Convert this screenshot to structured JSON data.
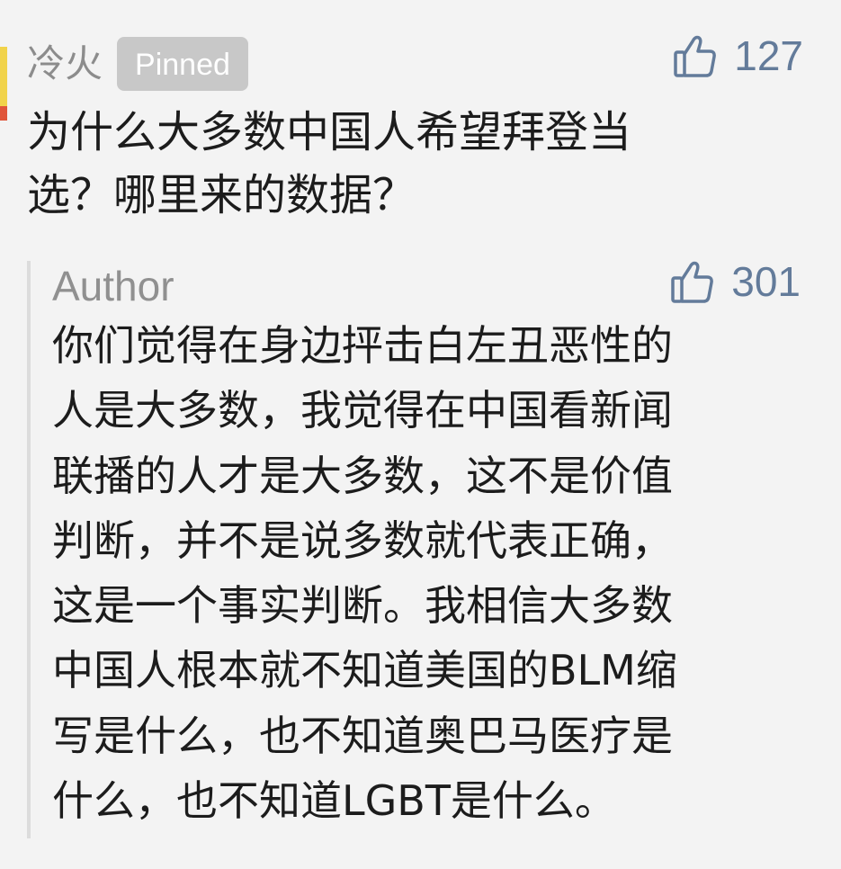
{
  "comment": {
    "username": "冷火",
    "badge": "Pinned",
    "likes": "127",
    "text": "为什么大多数中国人希望拜登当\n选？哪里来的数据？"
  },
  "reply": {
    "author_label": "Author",
    "likes": "301",
    "text": "你们觉得在身边抨击白左丑恶性的\n人是大多数，我觉得在中国看新闻\n联播的人才是大多数，这不是价值\n判断，并不是说多数就代表正确，\n这是一个事实判断。我相信大多数\n中国人根本就不知道美国的BLM缩\n写是什么，也不知道奥巴马医疗是\n什么，也不知道LGBT是什么。"
  },
  "colors": {
    "like_accent": "#637b9a",
    "muted_text": "#8c8c8c",
    "badge_bg": "#c8c8c8",
    "page_bg": "#f3f3f3",
    "edge_yellow": "#f1d34a",
    "edge_red": "#e0553a"
  },
  "icons": {
    "like": "thumbs-up-icon"
  }
}
